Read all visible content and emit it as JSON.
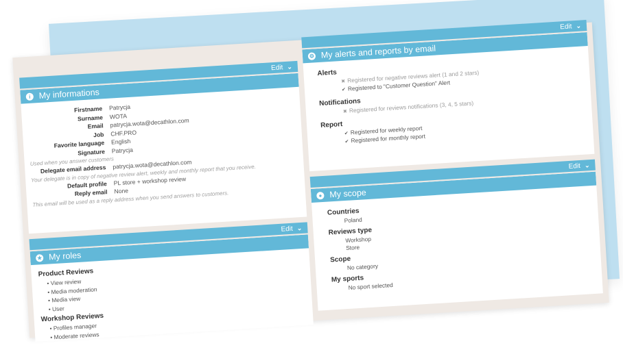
{
  "info": {
    "title": "My informations",
    "edit_label": "Edit",
    "fields": [
      {
        "label": "Firstname",
        "value": "Patrycja"
      },
      {
        "label": "Surname",
        "value": "WOTA"
      },
      {
        "label": "Email",
        "value": "patrycja.wota@decathlon.com"
      },
      {
        "label": "Job",
        "value": "CHF.PRO"
      },
      {
        "label": "Favorite language",
        "value": "English"
      },
      {
        "label": "Signature",
        "value": "Patrycja"
      }
    ],
    "signature_hint": "Used when you answer customers",
    "delegate": {
      "label": "Delegate email address",
      "value": "patrycja.wota@decathlon.com"
    },
    "delegate_hint": "Your delegate is in copy of negative review alert, weekly and monthly report that you receive.",
    "default_profile": {
      "label": "Default profile",
      "value": "PL store + workshop review"
    },
    "reply_email": {
      "label": "Reply email",
      "value": "None"
    },
    "reply_hint": "This email will be used as a reply address when you send answers to customers."
  },
  "roles": {
    "title": "My roles",
    "edit_label": "Edit",
    "groups": [
      {
        "name": "Product Reviews",
        "items": [
          "View review",
          "Media moderation",
          "Media view",
          "User"
        ]
      },
      {
        "name": "Workshop Reviews",
        "items": [
          "Profiles manager",
          "Moderate reviews"
        ]
      }
    ]
  },
  "alerts": {
    "title": "My alerts and reports by email",
    "edit_label": "Edit",
    "alerts_heading": "Alerts",
    "alerts_items": [
      {
        "mark": "✖",
        "text": "Registered for negative reviews alert (1 and 2 stars)",
        "active": false
      },
      {
        "mark": "✔",
        "text": "Registered to \"Customer Question\" Alert",
        "active": true
      }
    ],
    "notifications_heading": "Notifications",
    "notifications_items": [
      {
        "mark": "✖",
        "text": "Registered for reviews notifications (3, 4, 5 stars)",
        "active": false
      }
    ],
    "report_heading": "Report",
    "report_items": [
      {
        "mark": "✔",
        "text": "Registered for weekly report",
        "active": true
      },
      {
        "mark": "✔",
        "text": "Registered for monthly report",
        "active": true
      }
    ]
  },
  "scope": {
    "title": "My scope",
    "edit_label": "Edit",
    "countries_heading": "Countries",
    "countries": [
      "Poland"
    ],
    "reviews_type_heading": "Reviews type",
    "reviews_types": [
      "Workshop",
      "Store"
    ],
    "scope_heading": "Scope",
    "scope_value": "No category",
    "sports_heading": "My sports",
    "sports_value": "No sport selected"
  },
  "colors": {
    "accent": "#62b8d8",
    "backdrop": "#bedff0",
    "board": "#efe9e4"
  }
}
